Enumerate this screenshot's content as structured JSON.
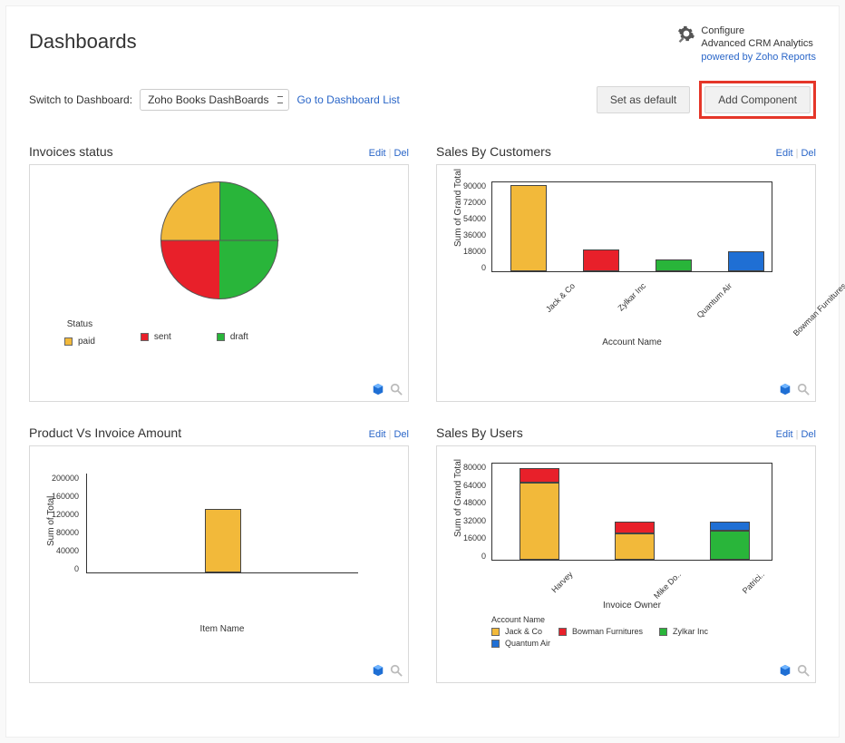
{
  "header": {
    "title": "Dashboards",
    "configure_line1": "Configure",
    "configure_line2": "Advanced CRM Analytics",
    "powered_link": "powered by Zoho Reports"
  },
  "switch": {
    "label": "Switch to Dashboard:",
    "selected": "Zoho Books DashBoards",
    "goto_link": "Go to Dashboard List"
  },
  "actions": {
    "set_default": "Set as default",
    "add_component": "Add Component"
  },
  "common": {
    "edit": "Edit",
    "del": "Del"
  },
  "cards": {
    "c1": {
      "title": "Invoices status",
      "legend_title": "Status"
    },
    "c2": {
      "title": "Sales By Customers",
      "ylabel": "Sum of Grand Total",
      "xlabel": "Account Name"
    },
    "c3": {
      "title": "Product Vs Invoice Amount",
      "ylabel": "Sum of Total",
      "xlabel": "Item Name"
    },
    "c4": {
      "title": "Sales By Users",
      "ylabel": "Sum of Grand Total",
      "xlabel": "Invoice Owner",
      "legend_title": "Account Name"
    }
  },
  "colors": {
    "paid": "#f2b93a",
    "sent": "#e8202a",
    "draft": "#29b53a",
    "blue": "#1f6fd4"
  },
  "chart_data": [
    {
      "id": "c1",
      "type": "pie",
      "title": "Invoices status",
      "series": [
        {
          "name": "paid",
          "value": 25,
          "color": "#f2b93a"
        },
        {
          "name": "sent",
          "value": 25,
          "color": "#e8202a"
        },
        {
          "name": "draft",
          "value": 50,
          "color": "#29b53a"
        }
      ]
    },
    {
      "id": "c2",
      "type": "bar",
      "title": "Sales By Customers",
      "ylabel": "Sum of Grand Total",
      "xlabel": "Account Name",
      "ylim": [
        0,
        90000
      ],
      "yticks": [
        0,
        18000,
        36000,
        54000,
        72000,
        90000
      ],
      "categories": [
        "Jack & Co",
        "Zylkar Inc",
        "Quantum Air",
        "Bowman Furnitures"
      ],
      "values": [
        87000,
        22000,
        12000,
        20000
      ],
      "colors": [
        "#f2b93a",
        "#e8202a",
        "#29b53a",
        "#1f6fd4"
      ]
    },
    {
      "id": "c3",
      "type": "bar",
      "title": "Product Vs Invoice Amount",
      "ylabel": "Sum of Total",
      "xlabel": "Item Name",
      "ylim": [
        0,
        200000
      ],
      "yticks": [
        0,
        40000,
        80000,
        120000,
        160000,
        200000
      ],
      "categories": [
        ""
      ],
      "values": [
        128000
      ],
      "colors": [
        "#f2b93a"
      ]
    },
    {
      "id": "c4",
      "type": "stacked-bar",
      "title": "Sales By Users",
      "ylabel": "Sum of Grand Total",
      "xlabel": "Invoice Owner",
      "ylim": [
        0,
        80000
      ],
      "yticks": [
        0,
        16000,
        32000,
        48000,
        64000,
        80000
      ],
      "categories": [
        "Harvey",
        "Mike Do..",
        "Patrici.."
      ],
      "legend": [
        "Jack & Co",
        "Bowman Furnitures",
        "Zylkar Inc",
        "Quantum Air"
      ],
      "legend_colors": [
        "#f2b93a",
        "#e8202a",
        "#29b53a",
        "#1f6fd4"
      ],
      "stacks": [
        [
          {
            "name": "Jack & Co",
            "value": 64000,
            "color": "#f2b93a"
          },
          {
            "name": "Bowman Furnitures",
            "value": 12000,
            "color": "#e8202a"
          }
        ],
        [
          {
            "name": "Jack & Co",
            "value": 22000,
            "color": "#f2b93a"
          },
          {
            "name": "Bowman Furnitures",
            "value": 10000,
            "color": "#e8202a"
          }
        ],
        [
          {
            "name": "Zylkar Inc",
            "value": 24000,
            "color": "#29b53a"
          },
          {
            "name": "Quantum Air",
            "value": 8000,
            "color": "#1f6fd4"
          }
        ]
      ]
    }
  ]
}
